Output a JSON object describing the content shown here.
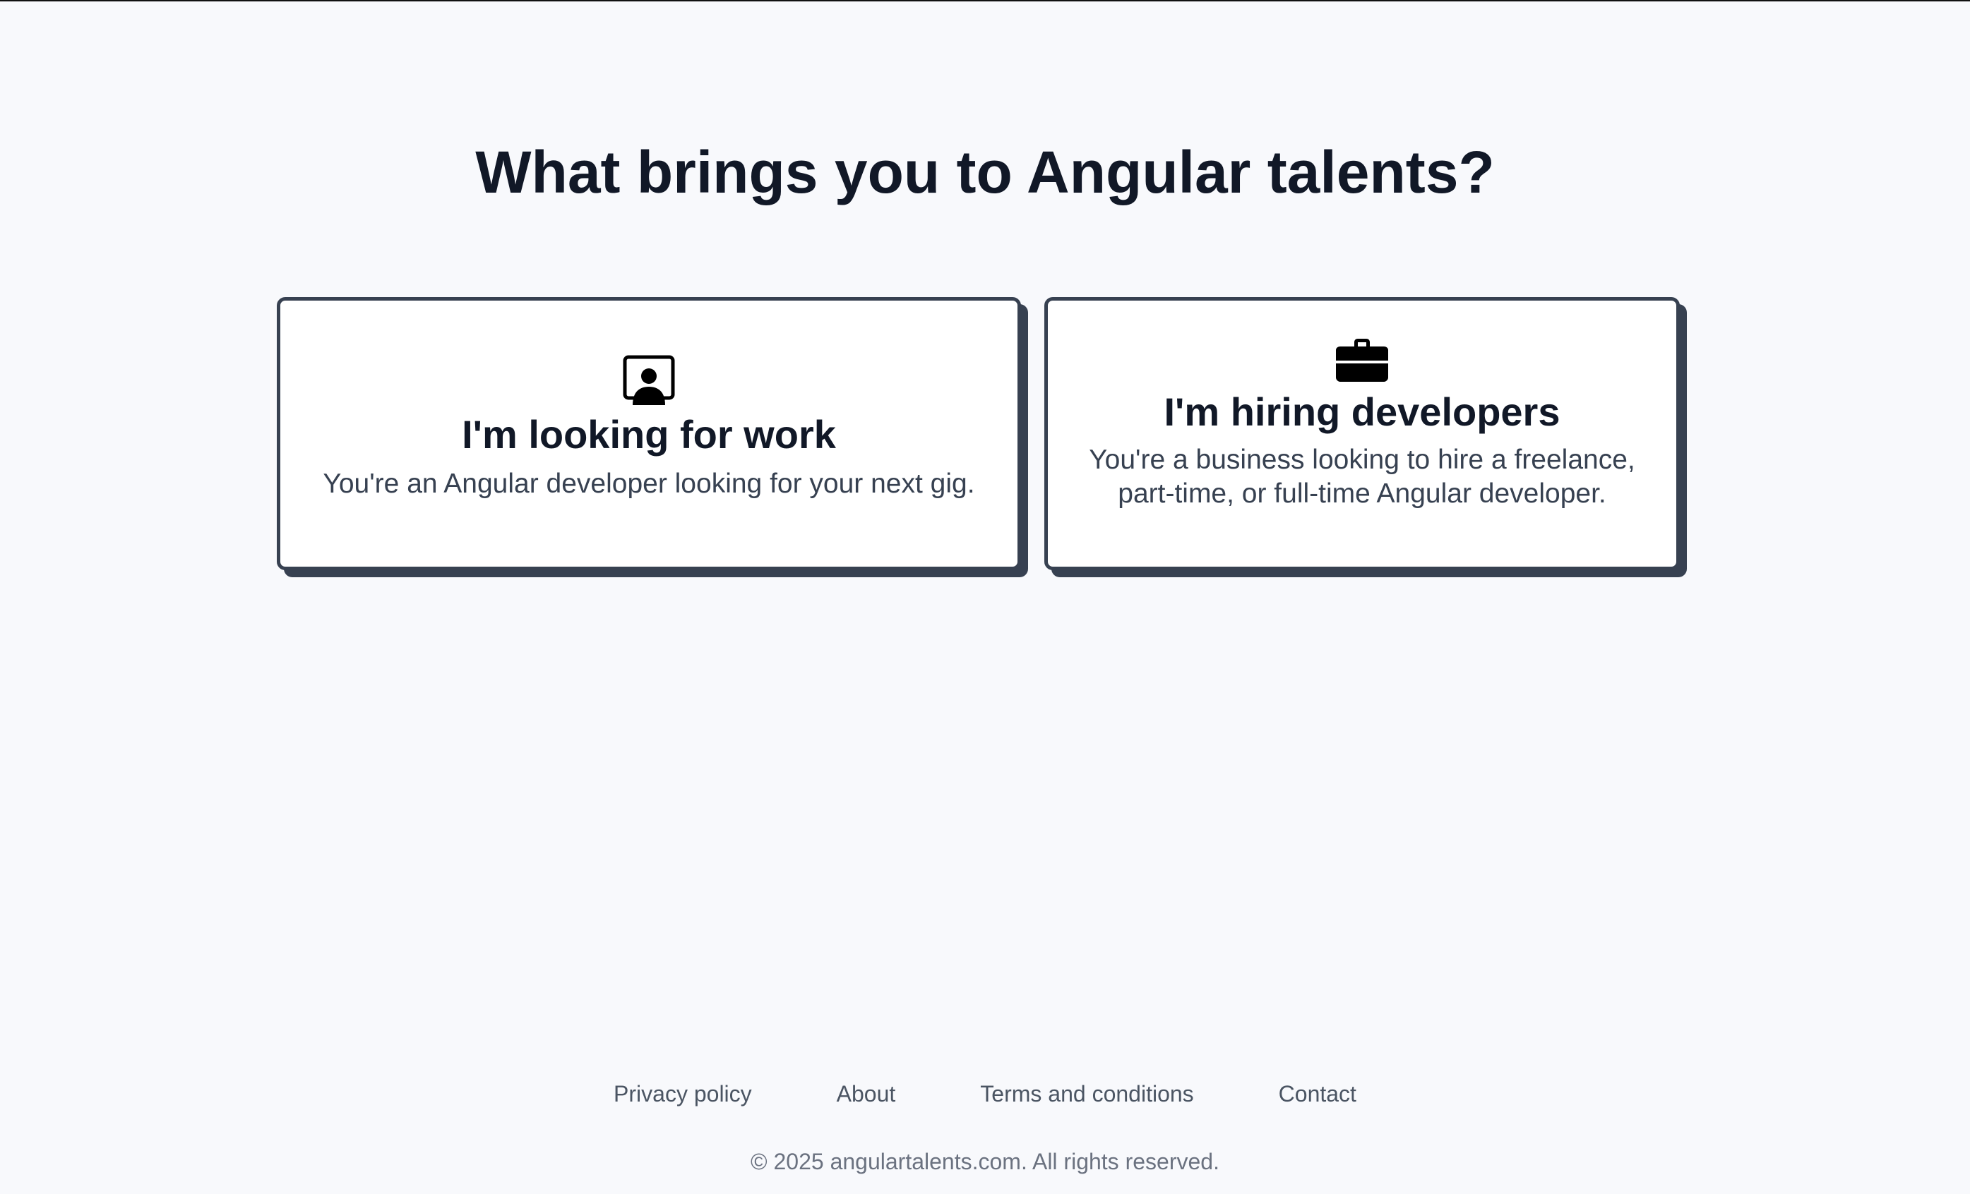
{
  "main": {
    "title": "What brings you to Angular talents?"
  },
  "cards": {
    "work": {
      "icon": "person-screen-icon",
      "heading": "I'm looking for work",
      "description": "You're an Angular developer looking for your next gig."
    },
    "hire": {
      "icon": "briefcase-icon",
      "heading": "I'm hiring developers",
      "description": "You're a business looking to hire a freelance, part-time, or full-time Angular developer."
    }
  },
  "footer": {
    "links": [
      "Privacy policy",
      "About",
      "Terms and conditions",
      "Contact"
    ],
    "copyright": "© 2025 angulartalents.com. All rights reserved."
  },
  "colors": {
    "background": "#f8f9fc",
    "heading": "#111827",
    "card_border": "#374151",
    "footer_text": "#4b5563"
  }
}
